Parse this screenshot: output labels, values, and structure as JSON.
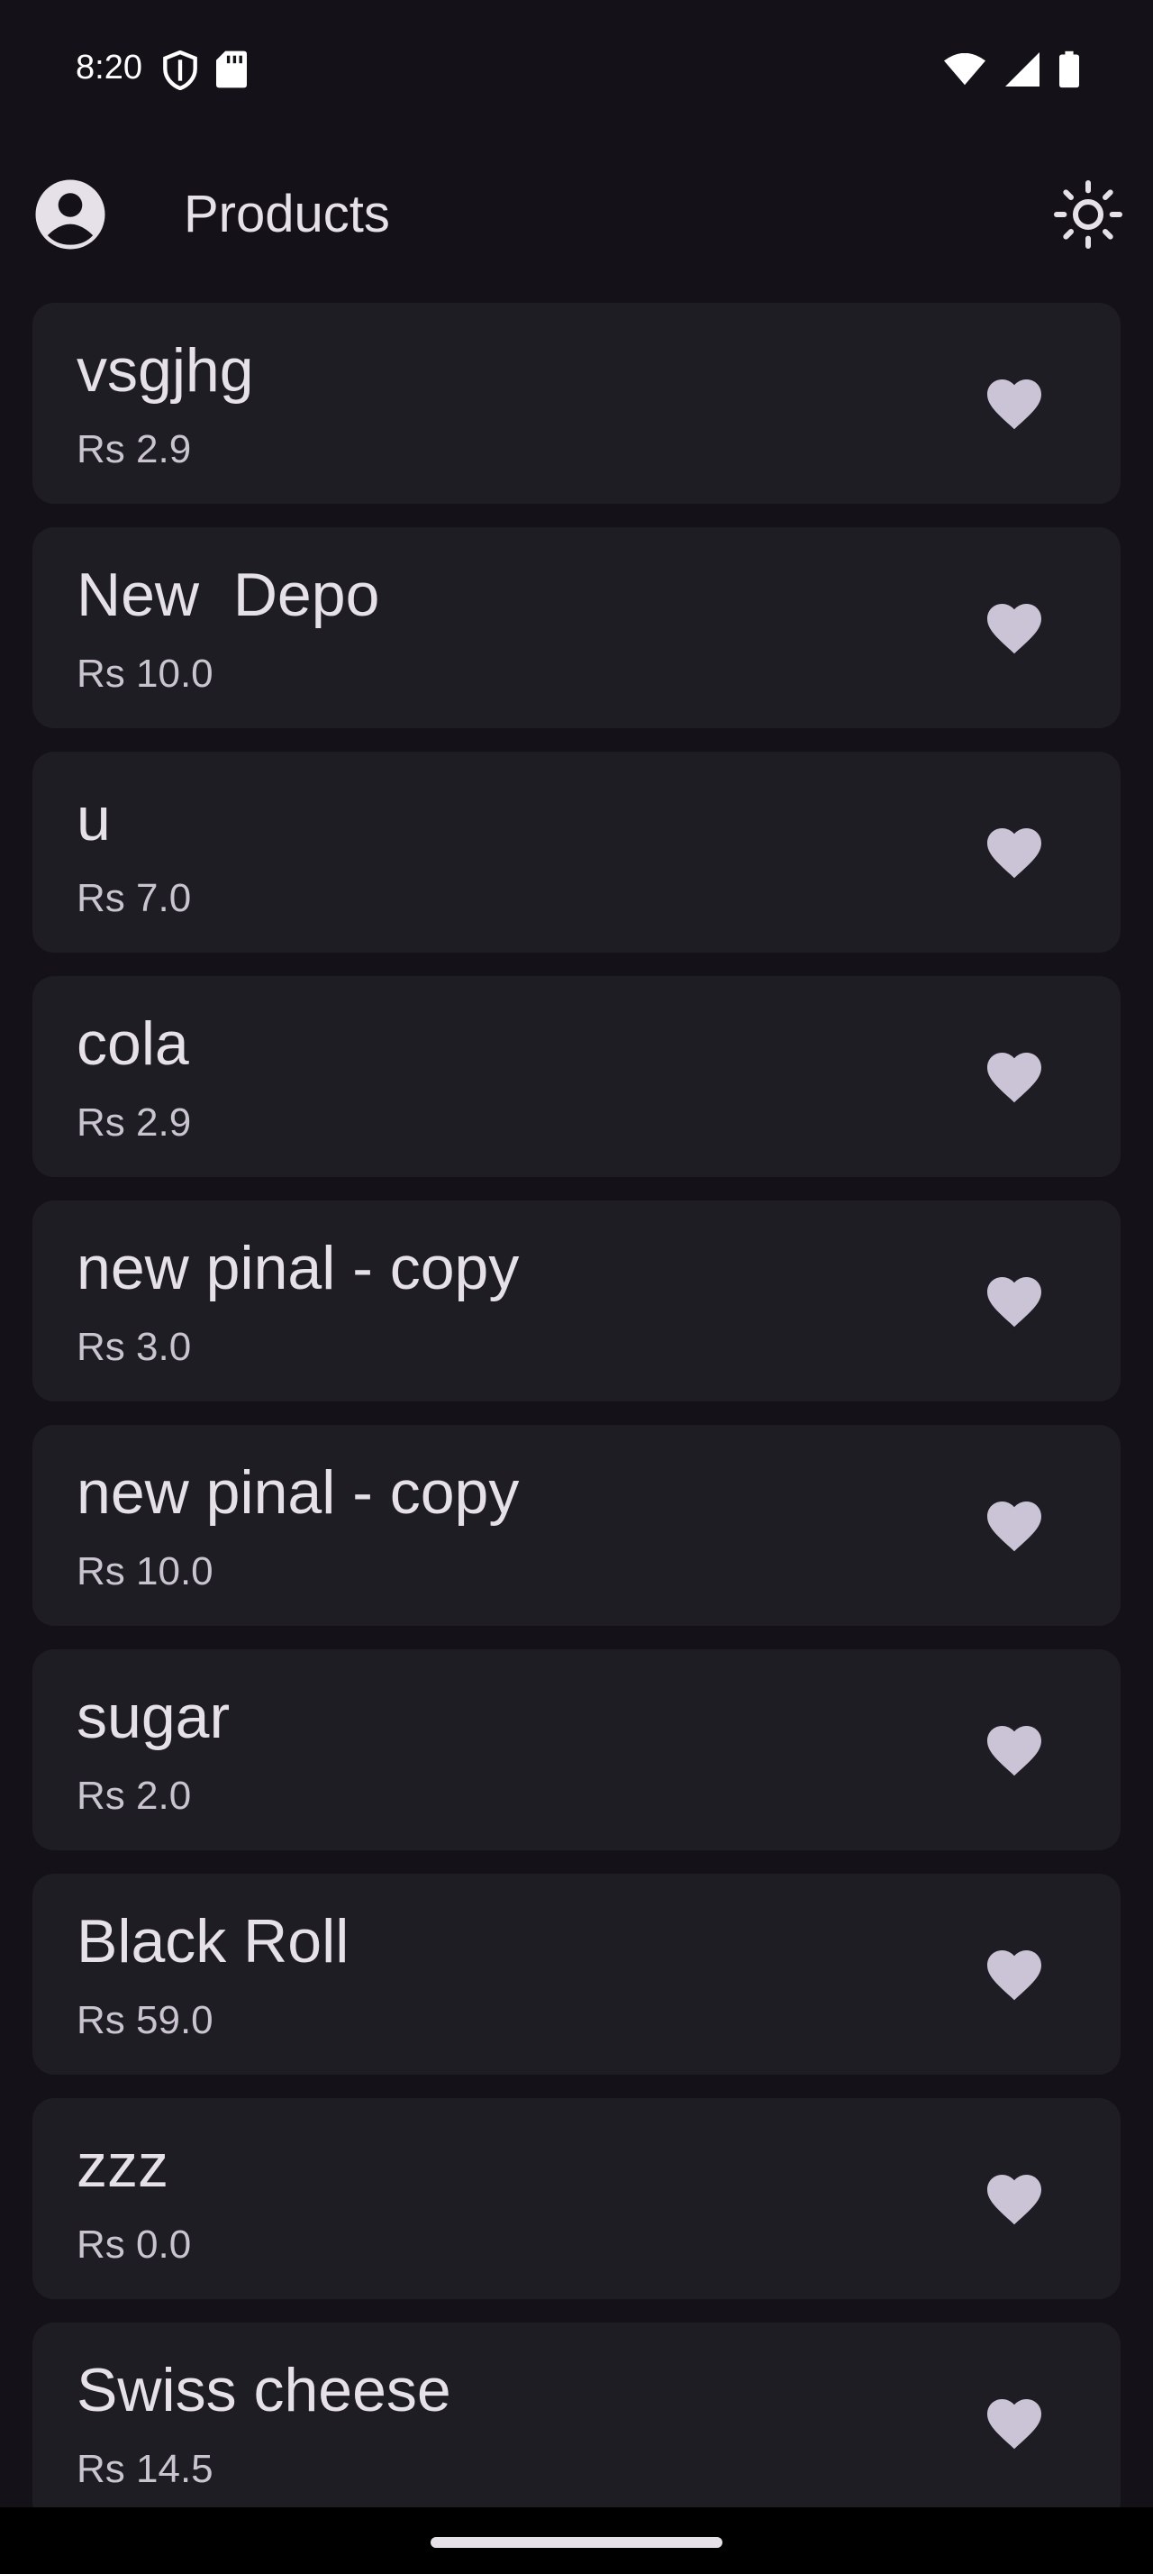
{
  "status_bar": {
    "time": "8:20",
    "left_icons": [
      "shield-icon",
      "sd-card-icon"
    ],
    "right_icons": [
      "wifi-icon",
      "signal-icon",
      "battery-icon"
    ]
  },
  "app_bar": {
    "title": "Products",
    "leading_icon": "account-circle-icon",
    "trailing_icon": "light-mode-icon"
  },
  "products": [
    {
      "name": "vsgjhg",
      "price": "Rs 2.9"
    },
    {
      "name": "New  Depo",
      "price": "Rs 10.0"
    },
    {
      "name": "u",
      "price": "Rs 7.0"
    },
    {
      "name": "cola",
      "price": "Rs 2.9"
    },
    {
      "name": "new pinal - copy",
      "price": "Rs 3.0"
    },
    {
      "name": "new pinal - copy",
      "price": "Rs 10.0"
    },
    {
      "name": "sugar",
      "price": "Rs 2.0"
    },
    {
      "name": "Black Roll",
      "price": "Rs 59.0"
    },
    {
      "name": "zzz",
      "price": "Rs 0.0"
    },
    {
      "name": "Swiss cheese",
      "price": "Rs 14.5"
    }
  ],
  "colors": {
    "background": "#141218",
    "card": "#1f1d24",
    "heart": "#cbc3d6",
    "text": "#e6e0e9"
  }
}
